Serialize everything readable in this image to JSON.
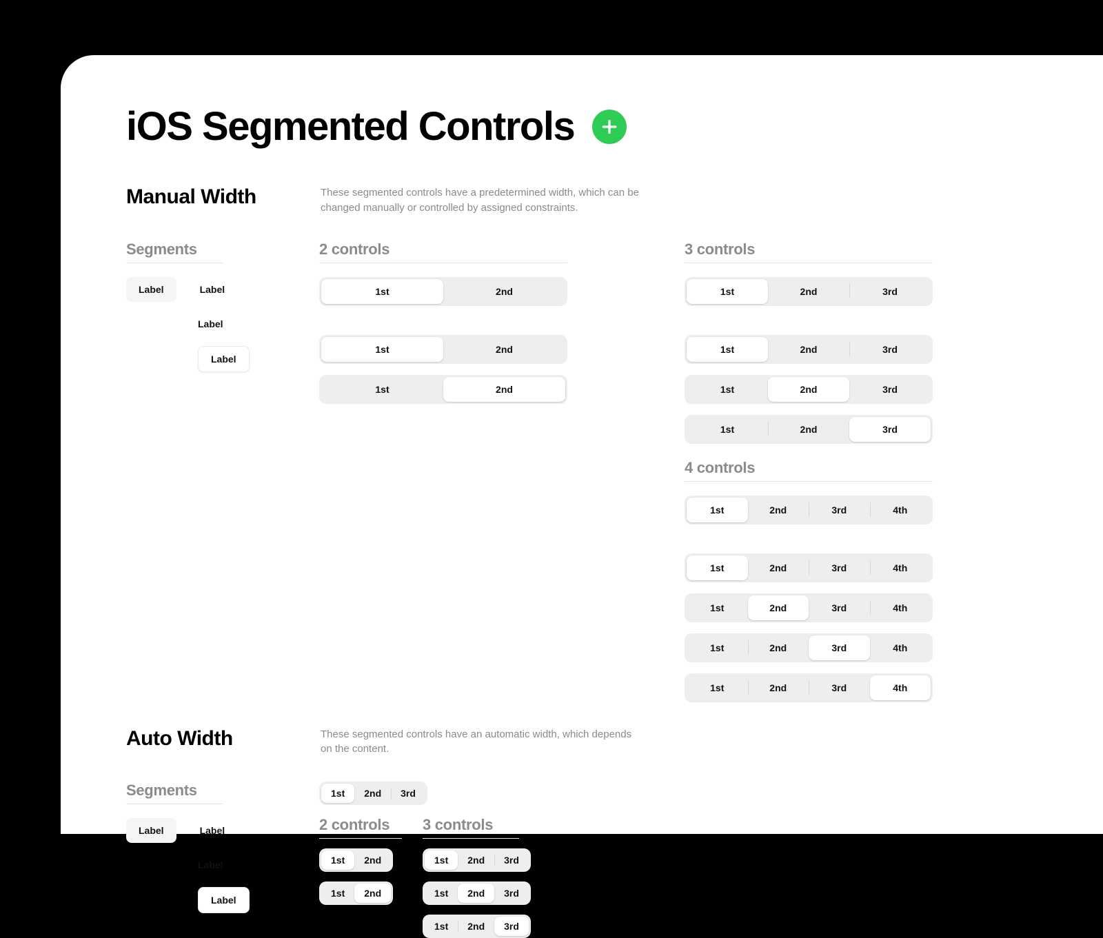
{
  "title": "iOS Segmented Controls",
  "sections": {
    "manual": {
      "heading": "Manual Width",
      "blurb": "These segmented controls have a predetermined width, which can be changed manually or controlled by assigned constraints."
    },
    "auto": {
      "heading": "Auto Width",
      "blurb": "These segmented controls have an automatic width, which depends on the content."
    }
  },
  "labels": {
    "segments_heading": "Segments",
    "two_controls": "2 controls",
    "three_controls": "3 controls",
    "four_controls": "4 controls",
    "chip": "Label"
  },
  "seg": {
    "first": "1st",
    "second": "2nd",
    "third": "3rd",
    "fourth": "4th"
  }
}
